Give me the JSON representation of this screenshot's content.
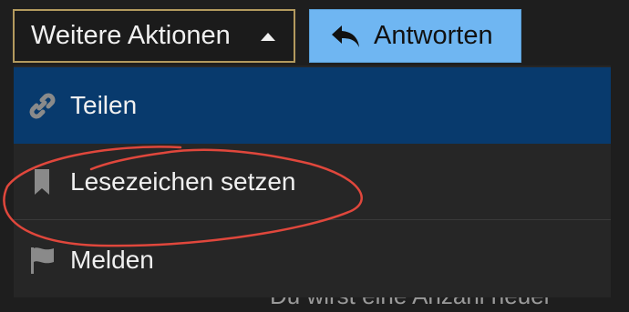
{
  "toolbar": {
    "more_actions_label": "Weitere Aktionen",
    "reply_label": "Antworten"
  },
  "menu": {
    "items": [
      {
        "label": "Teilen",
        "icon": "link-icon"
      },
      {
        "label": "Lesezeichen setzen",
        "icon": "bookmark-icon"
      },
      {
        "label": "Melden",
        "icon": "flag-icon"
      }
    ]
  },
  "background_text": "Du wirst eine Anzahl neuer",
  "colors": {
    "background": "#1e1e1e",
    "menu_background": "#262626",
    "selected_item": "#083a6d",
    "reply_button": "#6fb6f2",
    "dropdown_border": "#b39a5e",
    "annotation_stroke": "#e0473c"
  }
}
